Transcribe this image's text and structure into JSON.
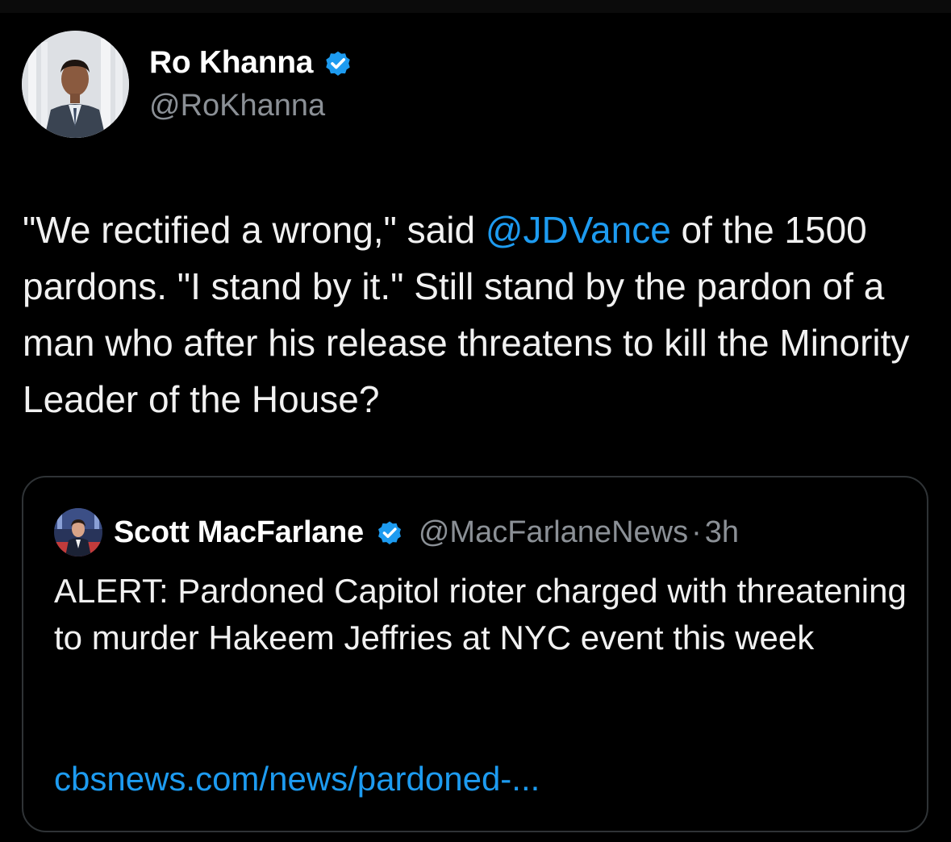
{
  "author": {
    "display_name": "Ro Khanna",
    "handle": "@RoKhanna",
    "verified_icon": "verified-badge-icon",
    "avatar": "profile-photo"
  },
  "tweet": {
    "text_part1": "\"We rectified a wrong,\" said ",
    "mention": "@JDVance",
    "text_part2": " of the 1500 pardons. \"I stand by it.\" Still stand by the pardon of a man who after his release threatens to kill the Minority Leader of the House?"
  },
  "quoted_tweet": {
    "display_name": "Scott MacFarlane",
    "handle": "@MacFarlaneNews",
    "separator": "·",
    "time": "3h",
    "text": "ALERT:  Pardoned Capitol rioter charged with threatening to murder Hakeem Jeffries at NYC event this week",
    "link": "cbsnews.com/news/pardoned-..."
  },
  "colors": {
    "background": "#000000",
    "text": "#e7e9ea",
    "secondary": "#8b9096",
    "accent": "#1d9bf0",
    "border": "#2f3336"
  }
}
